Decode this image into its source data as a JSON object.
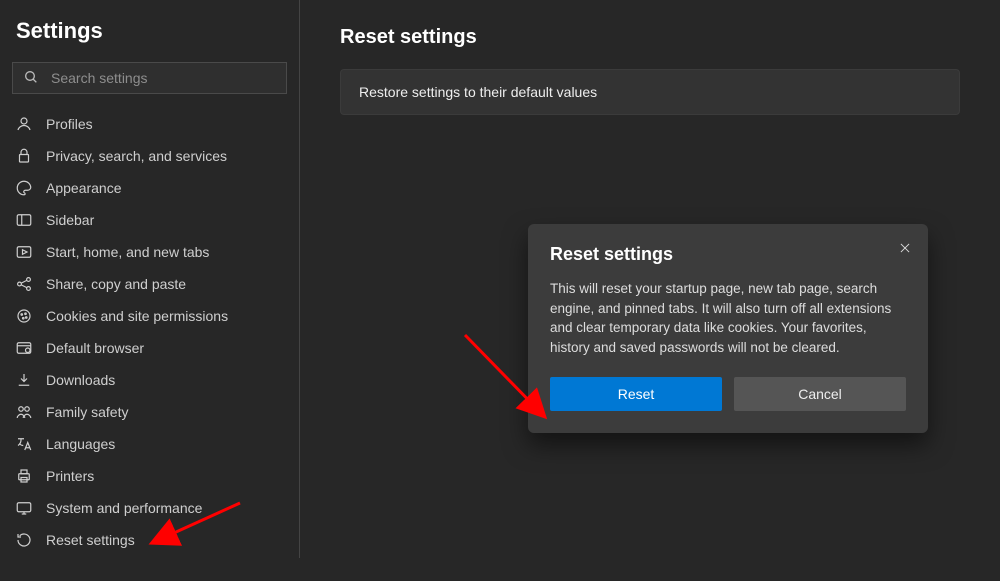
{
  "sidebar": {
    "title": "Settings",
    "search_placeholder": "Search settings",
    "items": [
      {
        "id": "profiles",
        "label": "Profiles"
      },
      {
        "id": "privacy",
        "label": "Privacy, search, and services"
      },
      {
        "id": "appearance",
        "label": "Appearance"
      },
      {
        "id": "sidebar",
        "label": "Sidebar"
      },
      {
        "id": "start",
        "label": "Start, home, and new tabs"
      },
      {
        "id": "share",
        "label": "Share, copy and paste"
      },
      {
        "id": "cookies",
        "label": "Cookies and site permissions"
      },
      {
        "id": "default",
        "label": "Default browser"
      },
      {
        "id": "downloads",
        "label": "Downloads"
      },
      {
        "id": "family",
        "label": "Family safety"
      },
      {
        "id": "languages",
        "label": "Languages"
      },
      {
        "id": "printers",
        "label": "Printers"
      },
      {
        "id": "system",
        "label": "System and performance"
      },
      {
        "id": "reset",
        "label": "Reset settings"
      }
    ]
  },
  "main": {
    "title": "Reset settings",
    "restore_row": "Restore settings to their default values"
  },
  "dialog": {
    "title": "Reset settings",
    "body": "This will reset your startup page, new tab page, search engine, and pinned tabs. It will also turn off all extensions and clear temporary data like cookies. Your favorites, history and saved passwords will not be cleared.",
    "reset_label": "Reset",
    "cancel_label": "Cancel"
  },
  "colors": {
    "accent": "#0078d4",
    "bg": "#272727",
    "panel": "#333333",
    "dialog": "#3c3c3c"
  }
}
